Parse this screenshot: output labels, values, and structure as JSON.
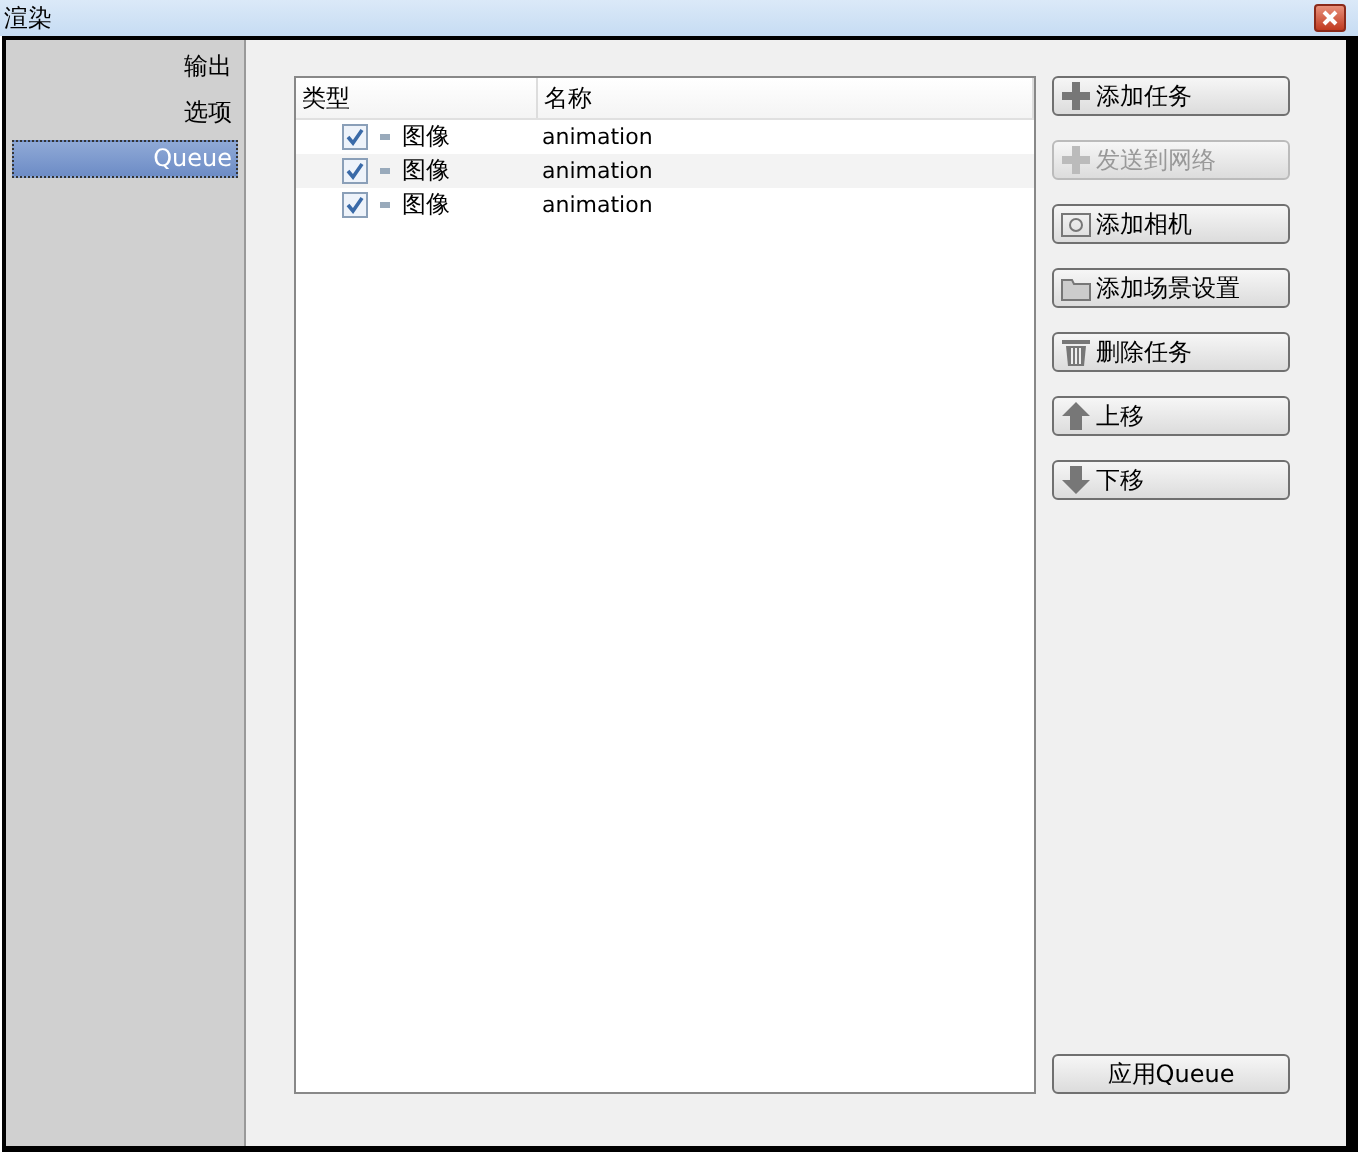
{
  "window": {
    "title": "渲染"
  },
  "sidebar": {
    "items": [
      {
        "label": "输出",
        "selected": false
      },
      {
        "label": "选项",
        "selected": false
      },
      {
        "label": "Queue",
        "selected": true
      }
    ]
  },
  "table": {
    "columns": [
      "类型",
      "名称"
    ],
    "rows": [
      {
        "checked": true,
        "type": "图像",
        "name": "animation"
      },
      {
        "checked": true,
        "type": "图像",
        "name": "animation"
      },
      {
        "checked": true,
        "type": "图像",
        "name": "animation"
      }
    ]
  },
  "buttons": [
    {
      "kind": "plus",
      "label": "添加任务",
      "disabled": false
    },
    {
      "kind": "plus",
      "label": "发送到网络",
      "disabled": true
    },
    {
      "kind": "camera",
      "label": "添加相机",
      "disabled": false
    },
    {
      "kind": "folder",
      "label": "添加场景设置",
      "disabled": false
    },
    {
      "kind": "trash",
      "label": "删除任务",
      "disabled": false
    },
    {
      "kind": "up",
      "label": "上移",
      "disabled": false
    },
    {
      "kind": "down",
      "label": "下移",
      "disabled": false
    }
  ],
  "apply_button": {
    "label": "应用Queue"
  }
}
